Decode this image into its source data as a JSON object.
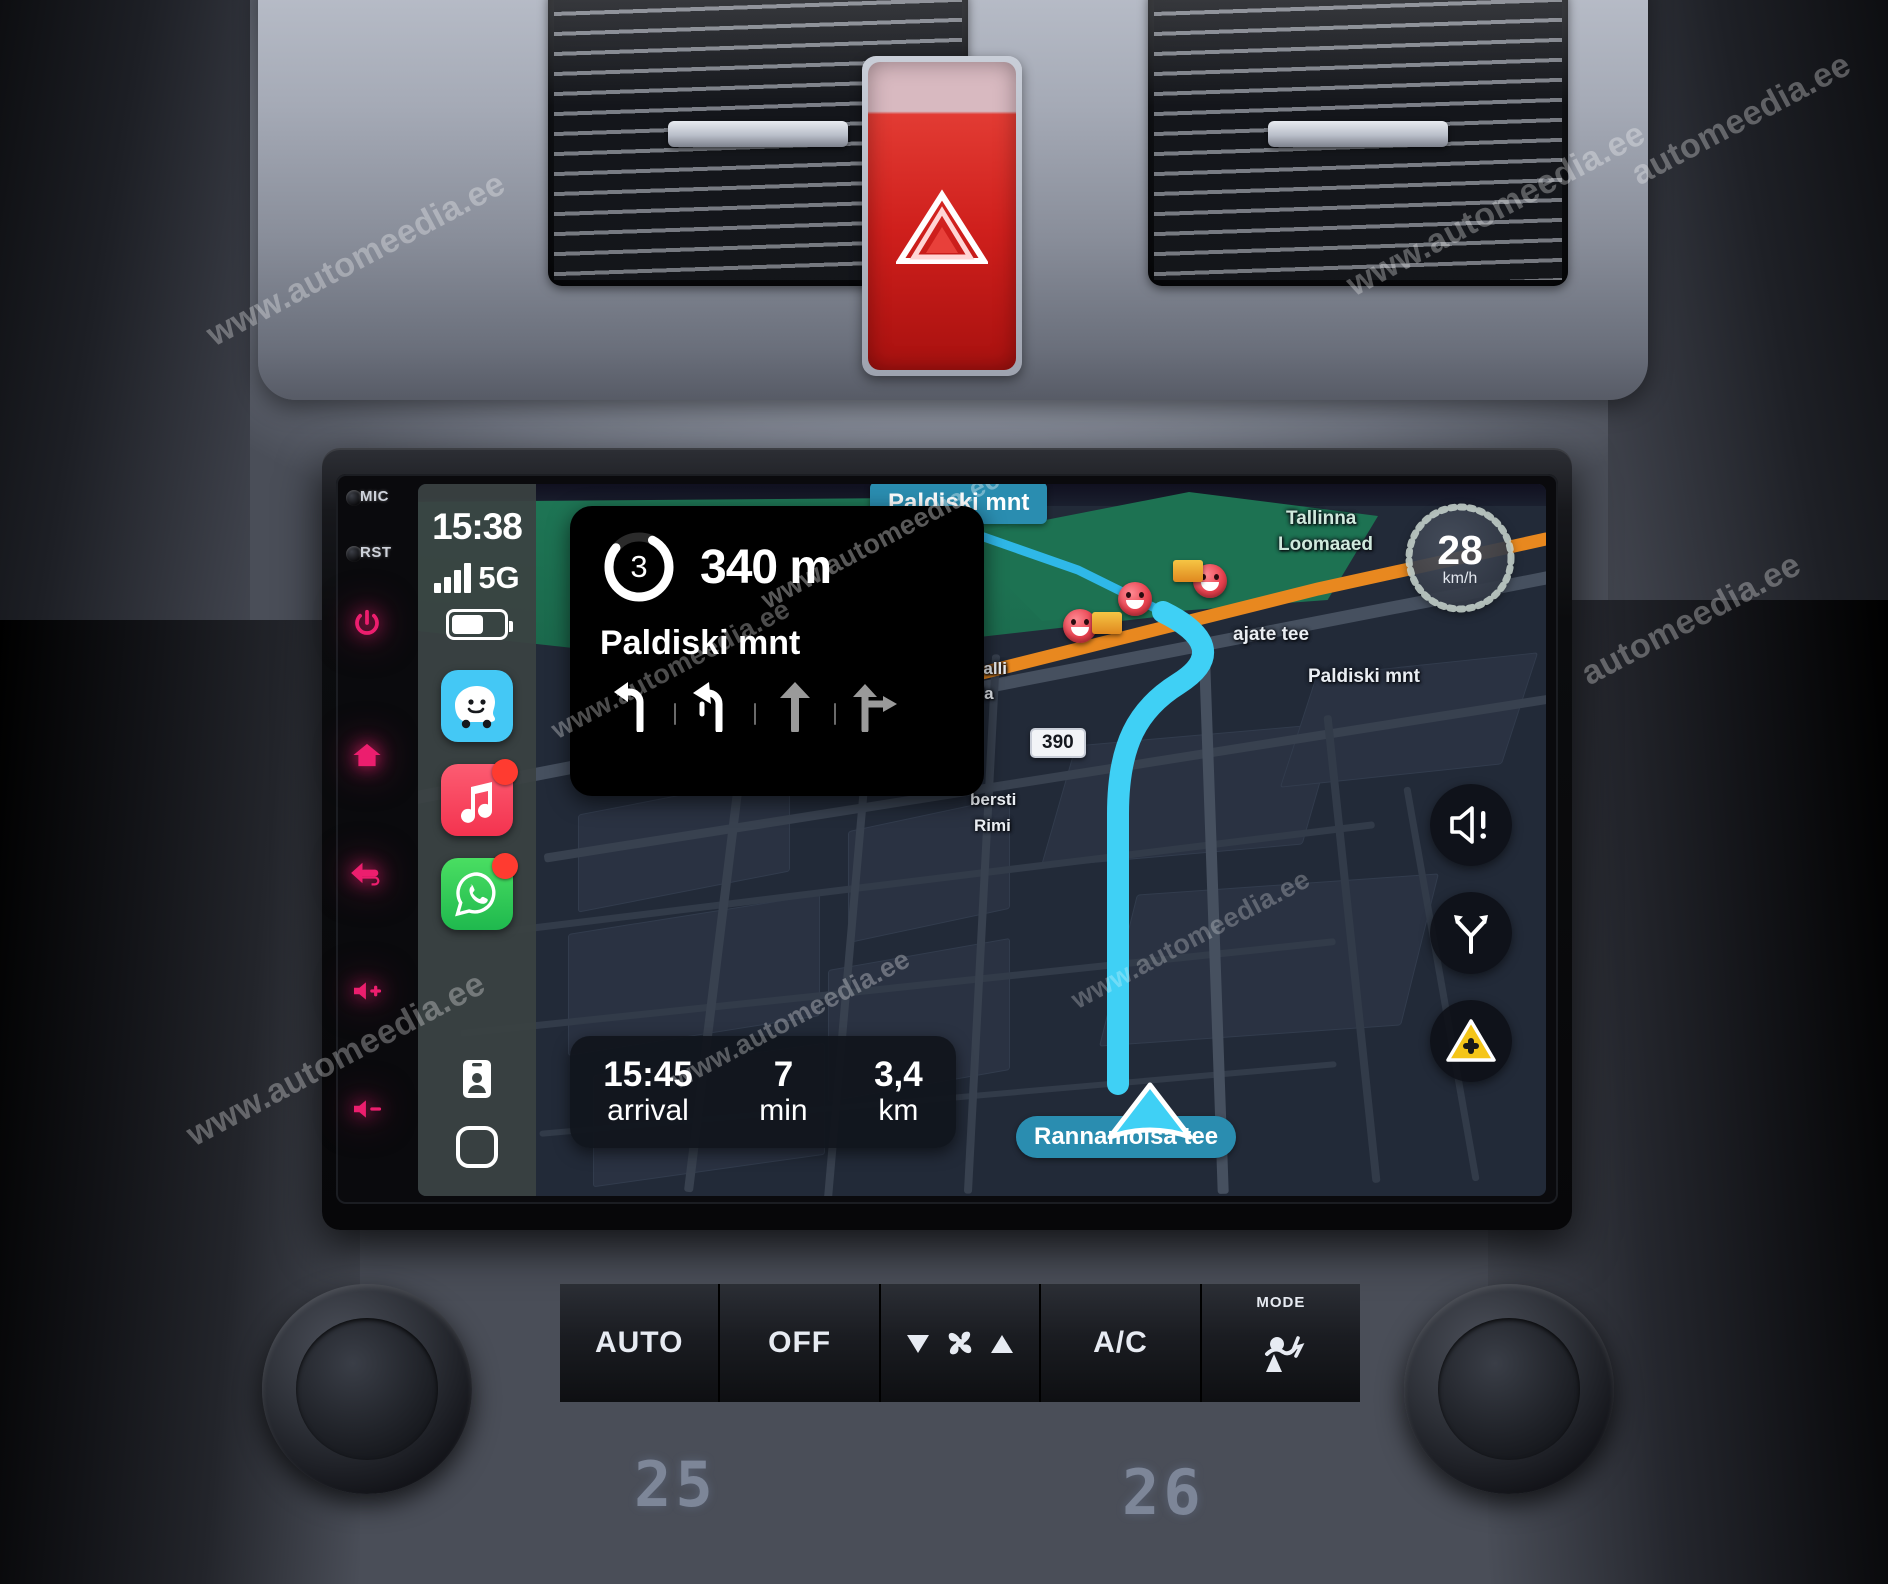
{
  "vehicle": {
    "hazard_button": "hazard-lights",
    "vents": [
      "left-air-vent",
      "right-air-vent"
    ]
  },
  "head_unit": {
    "rail": {
      "mic_label": "MIC",
      "rst_label": "RST",
      "buttons": [
        {
          "name": "power-button",
          "icon": "power-icon"
        },
        {
          "name": "home-button",
          "icon": "home-icon"
        },
        {
          "name": "back-button",
          "icon": "back-arrow-icon"
        },
        {
          "name": "volume-up-button",
          "icon": "volume-up-icon"
        },
        {
          "name": "volume-down-button",
          "icon": "volume-down-icon"
        }
      ]
    }
  },
  "carplay": {
    "status": {
      "time": "15:38",
      "network": "5G",
      "signal_bars": 4,
      "battery_percent": 62
    },
    "apps": [
      {
        "name": "waze",
        "label": "Waze",
        "color": "#44c8f5",
        "badge": false
      },
      {
        "name": "apple-music",
        "label": "Music",
        "color": "#fa4560",
        "badge": true
      },
      {
        "name": "whatsapp",
        "label": "WhatsApp",
        "color": "#25d366",
        "badge": true
      }
    ],
    "dock": [
      {
        "name": "contacts",
        "label": "Contacts"
      },
      {
        "name": "home-screen",
        "label": "Home"
      }
    ]
  },
  "navigation": {
    "instruction": {
      "countdown": "3",
      "distance": "340 m",
      "street": "Paldiski mnt",
      "lanes": [
        {
          "name": "lane-left-turn",
          "type": "left",
          "active": true
        },
        {
          "name": "lane-sharp-left",
          "type": "sharp-left",
          "active": true
        },
        {
          "name": "lane-straight",
          "type": "straight",
          "active": false
        },
        {
          "name": "lane-straight-right",
          "type": "straight-right",
          "active": false
        }
      ]
    },
    "eta": {
      "arrival_time": "15:45",
      "arrival_label": "arrival",
      "duration": "7",
      "duration_label": "min",
      "distance": "3,4",
      "distance_label": "km"
    },
    "speedometer": {
      "value": "28",
      "unit": "km/h"
    },
    "controls": [
      {
        "name": "sound-alerts-button",
        "icon": "speaker-alert-icon"
      },
      {
        "name": "alternate-routes-button",
        "icon": "route-fork-icon"
      },
      {
        "name": "report-button",
        "icon": "report-triangle-icon"
      }
    ],
    "map_labels": {
      "top_street": "Paldiski mnt",
      "right_street": "Paldiski mnt",
      "bottom_street": "Rannamõisa tee",
      "poi_zoo_line1": "Tallinna",
      "poi_zoo_line2": "Loomaaed",
      "poi_side_street": "ajate tee",
      "poi_halli": "halli",
      "poi_kla": "kla",
      "poi_bersti": "bersti",
      "poi_rimi": "Rimi",
      "route_shield": "390"
    }
  },
  "climate": {
    "buttons": [
      "AUTO",
      "OFF",
      "",
      "A/C",
      ""
    ],
    "auto_label": "AUTO",
    "off_label": "OFF",
    "ac_label": "A/C",
    "mode_label": "MODE",
    "fan_down_icon": "chevron-down-icon",
    "fan_icon": "fan-icon",
    "fan_up_icon": "chevron-up-icon",
    "temp_left": "25",
    "temp_right": "26"
  },
  "watermark": {
    "text": "www.automeedia.ee",
    "short": "automeedia.ee"
  }
}
